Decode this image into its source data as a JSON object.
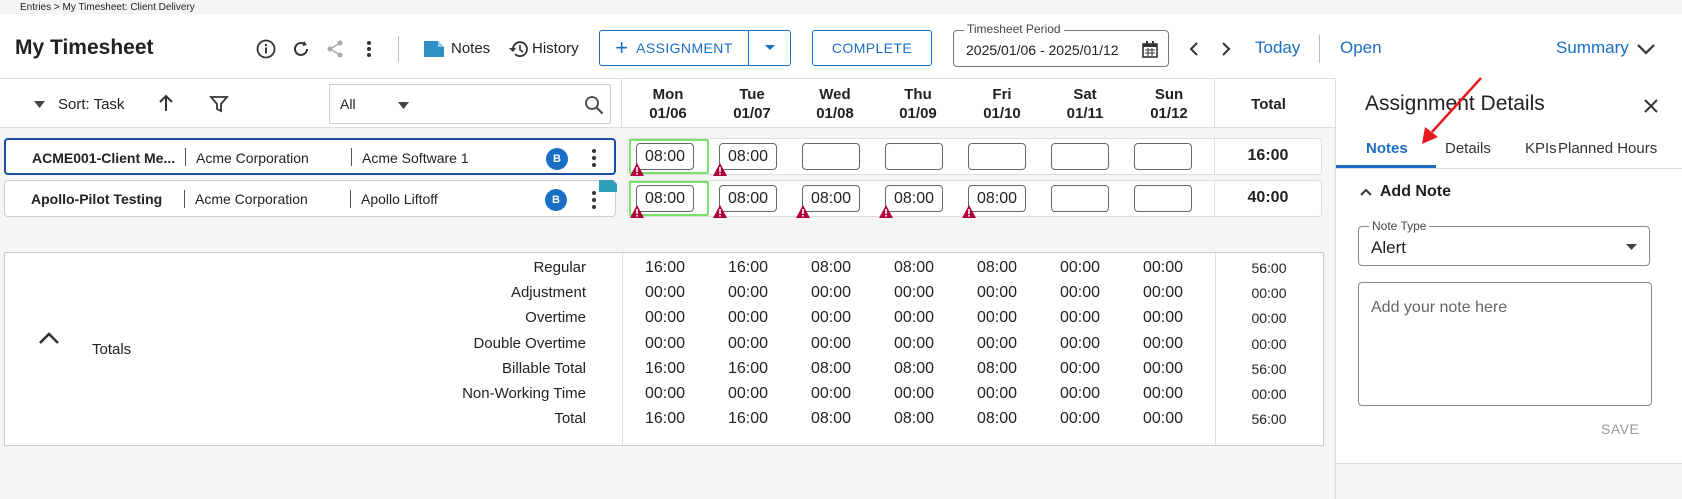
{
  "breadcrumb": "Entries > My Timesheet: Client Delivery",
  "header": {
    "title": "My Timesheet",
    "notes_label": "Notes",
    "history_label": "History",
    "assignment_label": "ASSIGNMENT",
    "complete_label": "COMPLETE",
    "period_label": "Timesheet Period",
    "period_value": "2025/01/06 - 2025/01/12",
    "today_label": "Today",
    "open_label": "Open",
    "summary_label": "Summary",
    "icons": [
      "info-icon",
      "refresh-icon",
      "share-icon",
      "more-vert-icon",
      "note-icon",
      "history-icon",
      "plus-icon",
      "chevron-down-icon",
      "calendar-icon",
      "chevron-left-icon",
      "chevron-right-icon"
    ]
  },
  "toolbar": {
    "sort_label": "Sort: Task",
    "filter_value": "All"
  },
  "days": [
    {
      "name": "Mon",
      "date": "01/06"
    },
    {
      "name": "Tue",
      "date": "01/07"
    },
    {
      "name": "Wed",
      "date": "01/08"
    },
    {
      "name": "Thu",
      "date": "01/09"
    },
    {
      "name": "Fri",
      "date": "01/10"
    },
    {
      "name": "Sat",
      "date": "01/11"
    },
    {
      "name": "Sun",
      "date": "01/12"
    }
  ],
  "total_header": "Total",
  "rows": [
    {
      "task": "ACME001-Client Me...",
      "client": "Acme Corporation",
      "project": "Acme Software 1",
      "badge": "B",
      "hours": [
        "08:00",
        "08:00",
        "",
        "",
        "",
        "",
        ""
      ],
      "warnings": [
        true,
        true,
        false,
        false,
        false,
        false,
        false
      ],
      "total": "16:00"
    },
    {
      "task": "Apollo-Pilot Testing",
      "client": "Acme Corporation",
      "project": "Apollo Liftoff",
      "badge": "B",
      "hours": [
        "08:00",
        "08:00",
        "08:00",
        "08:00",
        "08:00",
        "",
        ""
      ],
      "warnings": [
        true,
        true,
        true,
        true,
        true,
        false,
        false
      ],
      "total": "40:00"
    }
  ],
  "totals": {
    "label": "Totals",
    "rows": [
      {
        "label": "Regular",
        "values": [
          "16:00",
          "16:00",
          "08:00",
          "08:00",
          "08:00",
          "00:00",
          "00:00"
        ],
        "total": "56:00"
      },
      {
        "label": "Adjustment",
        "values": [
          "00:00",
          "00:00",
          "00:00",
          "00:00",
          "00:00",
          "00:00",
          "00:00"
        ],
        "total": "00:00"
      },
      {
        "label": "Overtime",
        "values": [
          "00:00",
          "00:00",
          "00:00",
          "00:00",
          "00:00",
          "00:00",
          "00:00"
        ],
        "total": "00:00"
      },
      {
        "label": "Double Overtime",
        "values": [
          "00:00",
          "00:00",
          "00:00",
          "00:00",
          "00:00",
          "00:00",
          "00:00"
        ],
        "total": "00:00"
      },
      {
        "label": "Billable Total",
        "values": [
          "16:00",
          "16:00",
          "08:00",
          "08:00",
          "08:00",
          "00:00",
          "00:00"
        ],
        "total": "56:00"
      },
      {
        "label": "Non-Working Time",
        "values": [
          "00:00",
          "00:00",
          "00:00",
          "00:00",
          "00:00",
          "00:00",
          "00:00"
        ],
        "total": "00:00"
      },
      {
        "label": "Total",
        "values": [
          "16:00",
          "16:00",
          "08:00",
          "08:00",
          "08:00",
          "00:00",
          "00:00"
        ],
        "total": "56:00"
      }
    ]
  },
  "panel": {
    "title": "Assignment Details",
    "tabs": [
      "Notes",
      "Details",
      "KPIs",
      "Planned Hours"
    ],
    "add_note_label": "Add Note",
    "note_type_label": "Note Type",
    "note_type_value": "Alert",
    "note_placeholder": "Add your note here",
    "save_label": "SAVE"
  },
  "colors": {
    "accent": "#1a6fc4",
    "warning": "#b0003a",
    "highlight": "#7ddf6e",
    "annotation_arrow": "#e8191c"
  }
}
